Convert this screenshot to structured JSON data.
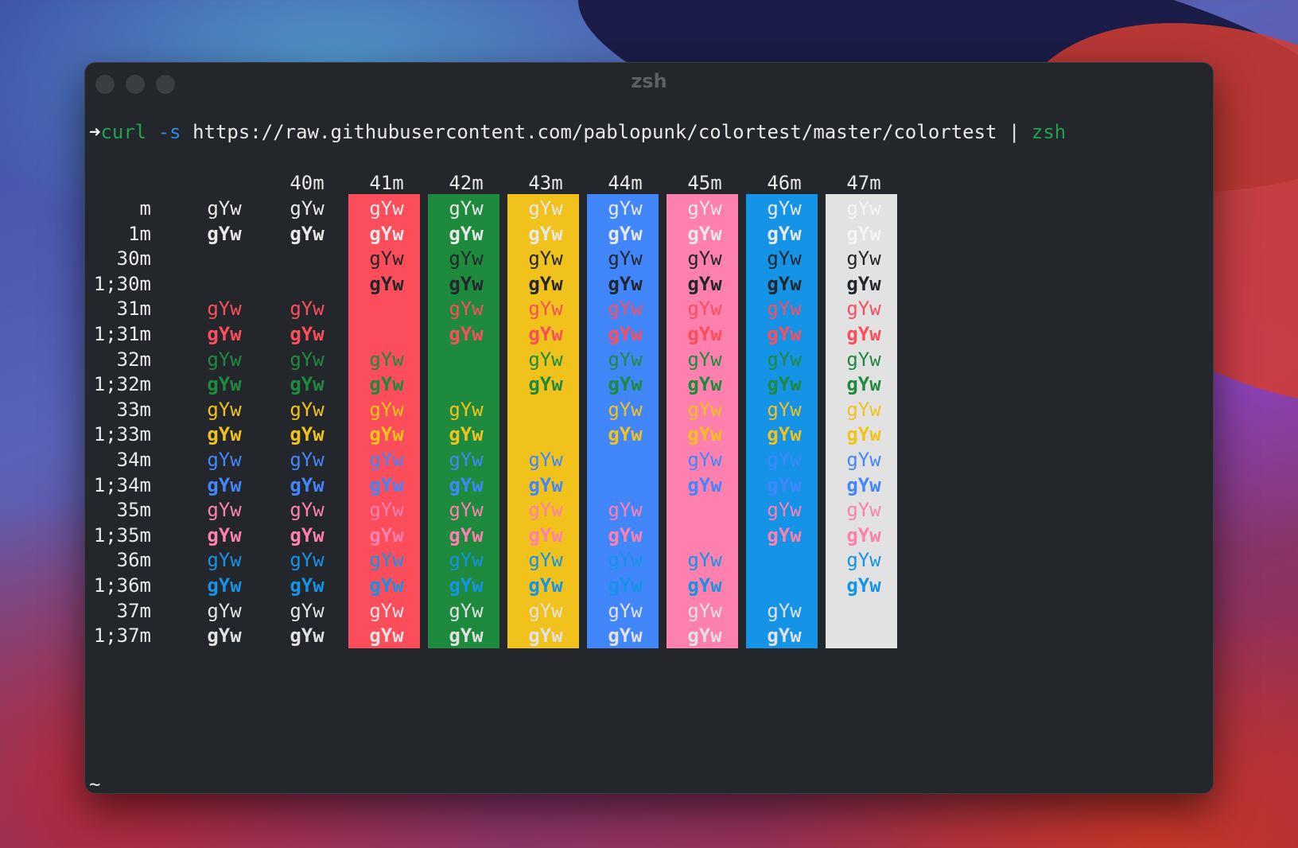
{
  "window": {
    "title": "zsh"
  },
  "command": {
    "prompt_symbol": "➜",
    "program": "curl",
    "flag": "-s",
    "url": "https://raw.githubusercontent.com/pablopunk/colortest/master/colortest",
    "pipe": "|",
    "shell": "zsh"
  },
  "colortest": {
    "sample_text": "gYw",
    "column_headers": [
      "",
      "40m",
      "41m",
      "42m",
      "43m",
      "44m",
      "45m",
      "46m",
      "47m"
    ],
    "row_labels": [
      "m",
      "1m",
      "30m",
      "1;30m",
      "31m",
      "1;31m",
      "32m",
      "1;32m",
      "33m",
      "1;33m",
      "34m",
      "1;34m",
      "35m",
      "1;35m",
      "36m",
      "1;36m",
      "37m",
      "1;37m"
    ],
    "palette": {
      "default": "#e8e8e8",
      "black": "#23272b",
      "red": "#fb4e5a",
      "green": "#1e8a3e",
      "yellow": "#f1c21b",
      "blue": "#4286fc",
      "magenta": "#fd80ae",
      "cyan": "#1493e7",
      "white": "#e2e2e2"
    },
    "background_colors": [
      "",
      "",
      "red",
      "green",
      "yellow",
      "blue",
      "magenta",
      "cyan",
      "white"
    ]
  },
  "prompt": {
    "tilde": "~",
    "symbol": "➜"
  }
}
